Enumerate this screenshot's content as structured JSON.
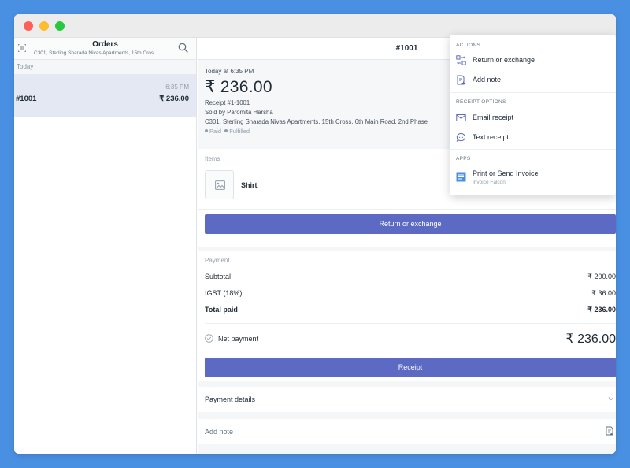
{
  "sidebar": {
    "title": "Orders",
    "subtitle": "C301, Sterling Sharada Nivas Apartments, 15th Cros...",
    "section": "Today",
    "orders": [
      {
        "id": "#1001",
        "time": "6:35 PM",
        "amount": "₹ 236.00"
      }
    ]
  },
  "header": {
    "title": "#1001",
    "more": "•••"
  },
  "summary": {
    "date": "Today at 6:35 PM",
    "amount": "₹ 236.00",
    "receipt": "Receipt #1-1001",
    "sold_by": "Sold by Paromita Harsha",
    "address": "C301, Sterling Sharada Nivas Apartments, 15th Cross, 6th Main Road, 2nd Phase",
    "status_paid": "Paid",
    "status_fulfilled": "Fulfilled"
  },
  "items": {
    "label": "Items",
    "list": [
      {
        "name": "Shirt"
      }
    ],
    "return_button": "Return or exchange"
  },
  "payment": {
    "label": "Payment",
    "subtotal_label": "Subtotal",
    "subtotal": "₹ 200.00",
    "tax_label": "IGST (18%)",
    "tax": "₹ 36.00",
    "total_label": "Total paid",
    "total": "₹ 236.00",
    "net_label": "Net payment",
    "net": "₹ 236.00",
    "receipt_button": "Receipt"
  },
  "details": {
    "payment_details": "Payment details",
    "add_note": "Add note"
  },
  "popover": {
    "actions_heading": "Actions",
    "return_exchange": "Return or exchange",
    "add_note": "Add note",
    "receipt_heading": "Receipt options",
    "email_receipt": "Email receipt",
    "text_receipt": "Text receipt",
    "apps_heading": "Apps",
    "print_invoice": "Print or Send Invoice",
    "print_invoice_sub": "Invoice Falcon"
  },
  "colors": {
    "accent": "#5c6ac4",
    "background": "#4a90e2"
  }
}
